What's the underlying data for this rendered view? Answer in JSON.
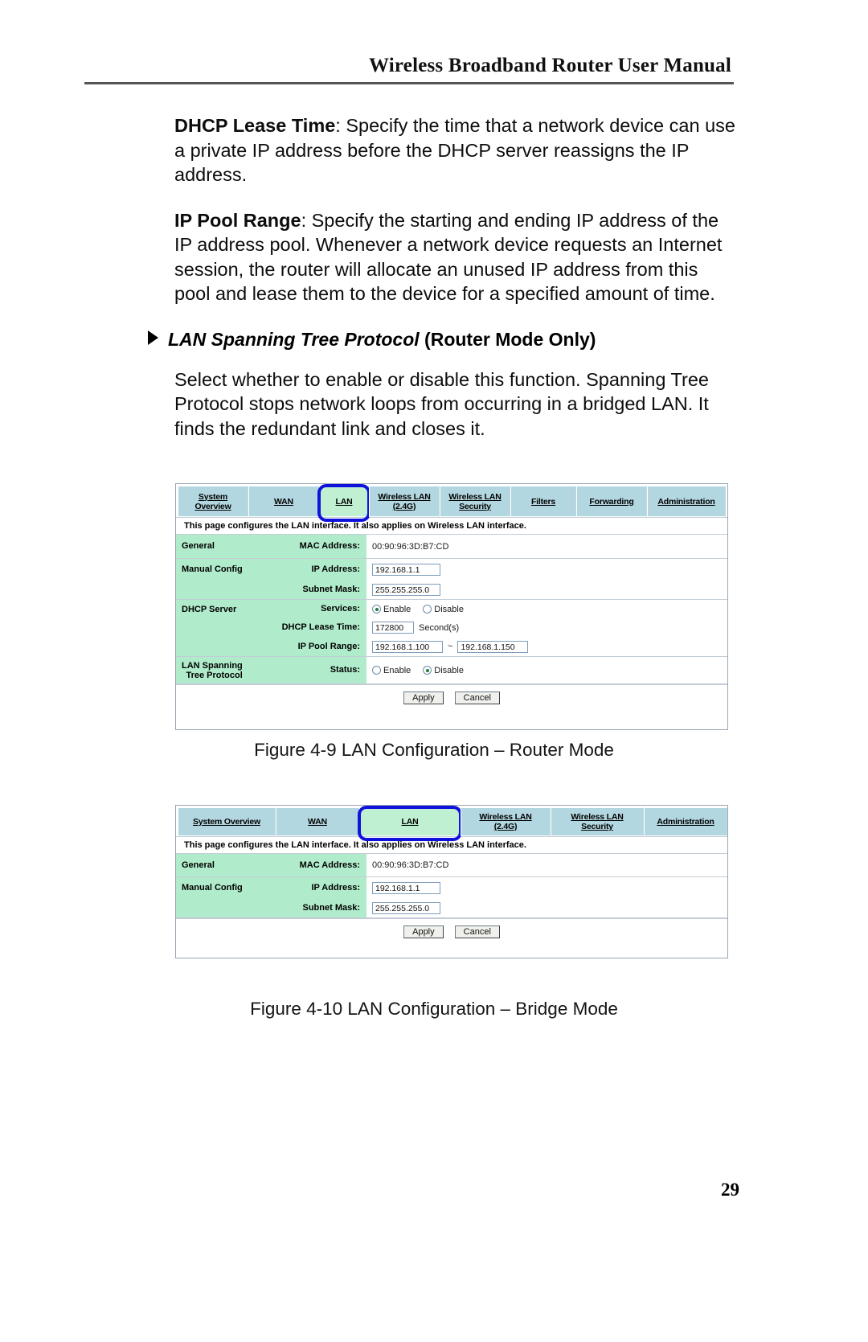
{
  "header": {
    "title": "Wireless Broadband Router User Manual"
  },
  "body": {
    "paragraphs": [
      {
        "lead": "DHCP Lease Time",
        "text": ": Specify the time that a network device can use a private IP address before the DHCP server reassigns the IP address."
      },
      {
        "lead": "IP Pool Range",
        "text": ": Specify the starting and ending IP address of the IP address pool. Whenever a network device requests an Internet session, the router will allocate an unused IP address from this pool and lease them to the device for a specified amount of time."
      }
    ],
    "heading": {
      "italic_part": "LAN Spanning Tree Protocol",
      "bold_part": "(Router Mode Only)"
    },
    "heading_body": "Select whether to enable or disable this function. Spanning Tree Protocol stops network loops from occurring in a bridged LAN. It finds the redundant link and closes it."
  },
  "figure_router": {
    "tabs": [
      {
        "label": "System Overview",
        "line1": "System",
        "line2": "Overview",
        "active": false
      },
      {
        "label": "WAN",
        "line1": "WAN",
        "line2": "",
        "active": false
      },
      {
        "label": "LAN",
        "line1": "LAN",
        "line2": "",
        "active": true
      },
      {
        "label": "Wireless LAN (2.4G)",
        "line1": "Wireless LAN",
        "line2": "(2.4G)",
        "active": false
      },
      {
        "label": "Wireless LAN Security",
        "line1": "Wireless LAN",
        "line2": "Security",
        "active": false
      },
      {
        "label": "Filters",
        "line1": "Filters",
        "line2": "",
        "active": false
      },
      {
        "label": "Forwarding",
        "line1": "Forwarding",
        "line2": "",
        "active": false
      },
      {
        "label": "Administration",
        "line1": "Administration",
        "line2": "",
        "active": false
      }
    ],
    "note": "This page configures the LAN interface. It also applies on Wireless LAN interface.",
    "general": {
      "group": "General",
      "mac_label": "MAC Address:",
      "mac_value": "00:90:96:3D:B7:CD"
    },
    "manual_config": {
      "group": "Manual Config",
      "ip_label": "IP Address:",
      "ip_value": "192.168.1.1",
      "mask_label": "Subnet Mask:",
      "mask_value": "255.255.255.0"
    },
    "dhcp_server": {
      "group": "DHCP Server",
      "services_label": "Services:",
      "enable_label": "Enable",
      "disable_label": "Disable",
      "services_selected": "Enable",
      "lease_label": "DHCP Lease Time:",
      "lease_value": "172800",
      "lease_unit": "Second(s)",
      "pool_label": "IP Pool Range:",
      "pool_start": "192.168.1.100",
      "pool_sep": "~",
      "pool_end": "192.168.1.150"
    },
    "stp": {
      "group_line1": "LAN Spanning",
      "group_line2": "Tree Protocol",
      "status_label": "Status:",
      "enable_label": "Enable",
      "disable_label": "Disable",
      "status_selected": "Disable"
    },
    "actions": {
      "apply": "Apply",
      "cancel": "Cancel"
    },
    "caption": "Figure 4-9  LAN Configuration – Router Mode"
  },
  "figure_bridge": {
    "tabs": [
      {
        "label": "System Overview",
        "line1": "System Overview",
        "line2": "",
        "active": false
      },
      {
        "label": "WAN",
        "line1": "WAN",
        "line2": "",
        "active": false
      },
      {
        "label": "LAN",
        "line1": "LAN",
        "line2": "",
        "active": true
      },
      {
        "label": "Wireless LAN (2.4G)",
        "line1": "Wireless LAN",
        "line2": "(2.4G)",
        "active": false
      },
      {
        "label": "Wireless LAN Security",
        "line1": "Wireless LAN",
        "line2": "Security",
        "active": false
      },
      {
        "label": "Administration",
        "line1": "Administration",
        "line2": "",
        "active": false
      }
    ],
    "note": "This page configures the LAN interface. It also applies on Wireless LAN interface.",
    "general": {
      "group": "General",
      "mac_label": "MAC Address:",
      "mac_value": "00:90:96:3D:B7:CD"
    },
    "manual_config": {
      "group": "Manual Config",
      "ip_label": "IP Address:",
      "ip_value": "192.168.1.1",
      "mask_label": "Subnet Mask:",
      "mask_value": "255.255.255.0"
    },
    "actions": {
      "apply": "Apply",
      "cancel": "Cancel"
    },
    "caption": "Figure 4-10  LAN Configuration – Bridge Mode"
  },
  "footer": {
    "page_number": "29"
  }
}
